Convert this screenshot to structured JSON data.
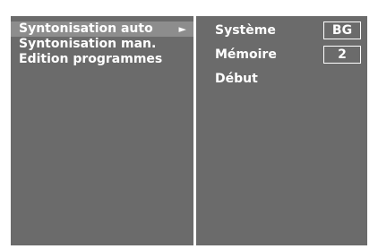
{
  "menu": {
    "items": [
      {
        "label": "Syntonisation auto",
        "arrow": "►"
      },
      {
        "label": "Syntonisation man."
      },
      {
        "label": "Edition programmes"
      }
    ]
  },
  "panel": {
    "systeme_label": "Système",
    "systeme_value": "BG",
    "memoire_label": "Mémoire",
    "memoire_value": "2",
    "debut_label": "Début"
  },
  "colors": {
    "osd_background": "#6b6b6b",
    "selection_highlight": "#8d8d8d",
    "text": "#ffffff"
  }
}
